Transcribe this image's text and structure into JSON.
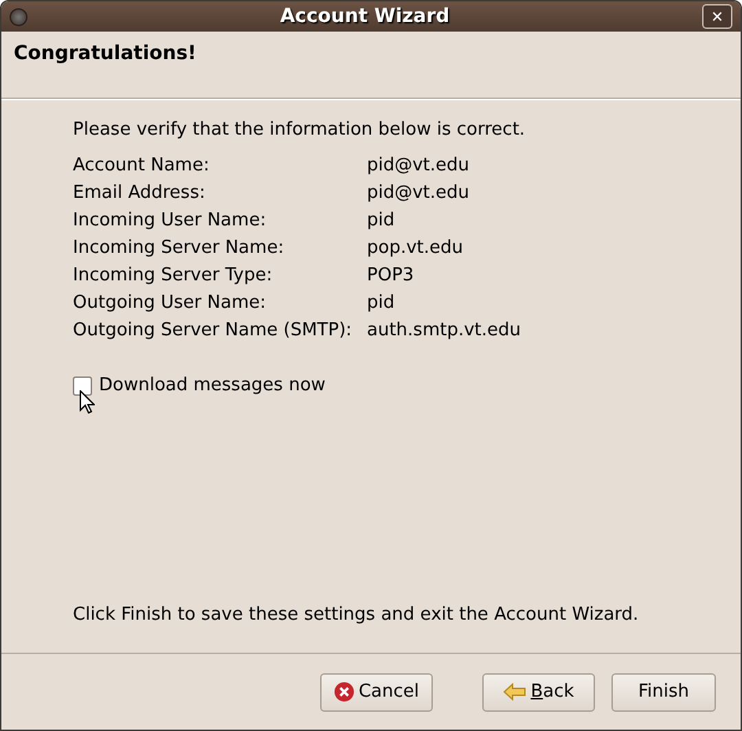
{
  "window": {
    "title": "Account Wizard",
    "close": "✕"
  },
  "header": {
    "title": "Congratulations!"
  },
  "intro": "Please verify that the information below is correct.",
  "fields": [
    {
      "label": "Account Name:",
      "value": "pid@vt.edu"
    },
    {
      "label": "Email Address:",
      "value": "pid@vt.edu"
    },
    {
      "label": "Incoming User Name:",
      "value": "pid"
    },
    {
      "label": "Incoming Server Name:",
      "value": "pop.vt.edu"
    },
    {
      "label": "Incoming Server Type:",
      "value": "POP3"
    },
    {
      "label": "Outgoing User Name:",
      "value": "pid"
    },
    {
      "label": "Outgoing Server Name (SMTP):",
      "value": "auth.smtp.vt.edu"
    }
  ],
  "download": {
    "label": "Download messages now",
    "checked": false
  },
  "footer_note": "Click Finish to save these settings and exit the Account Wizard.",
  "buttons": [
    {
      "kind": "cancel",
      "label": "Cancel"
    },
    {
      "kind": "back",
      "label": "Back"
    },
    {
      "kind": "finish",
      "label": "Finish"
    }
  ]
}
